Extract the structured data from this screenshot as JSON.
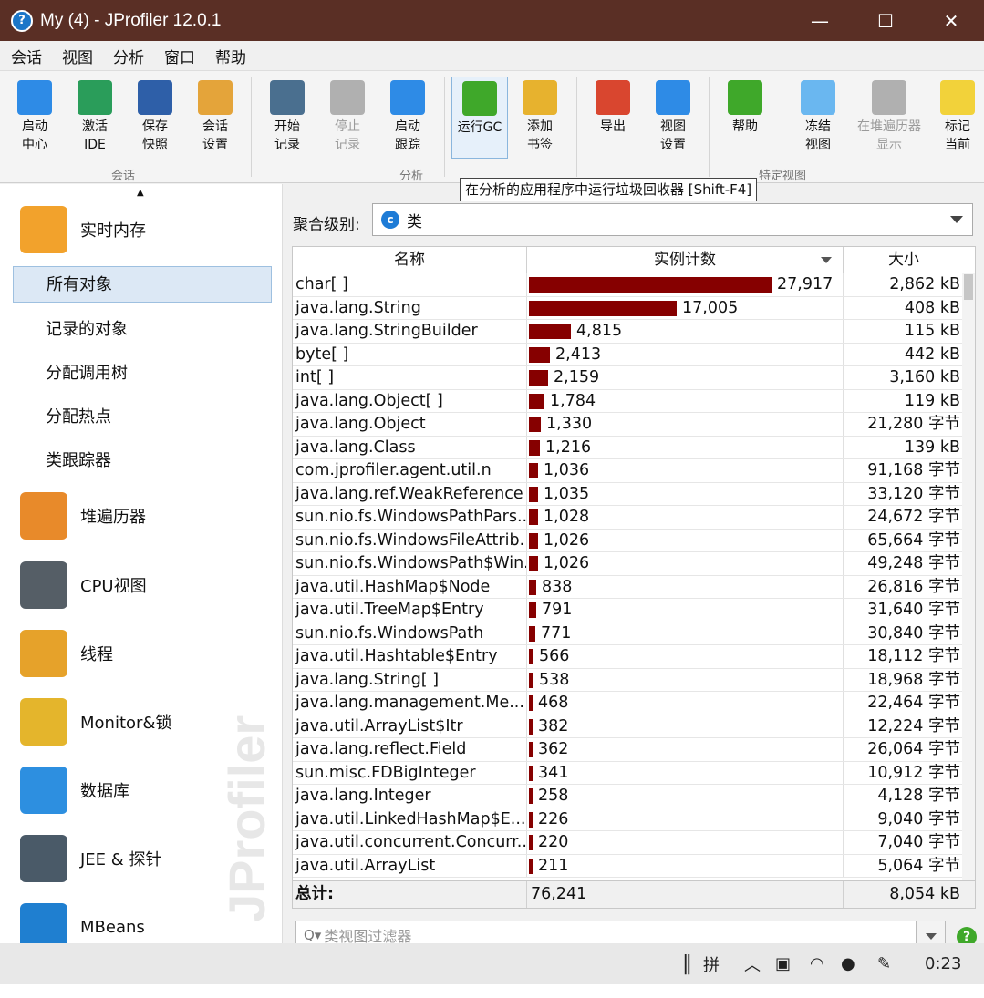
{
  "window": {
    "title": "My (4) - JProfiler 12.0.1",
    "minimize": "—",
    "maximize": "☐",
    "close": "✕"
  },
  "menu": [
    "会话",
    "视图",
    "分析",
    "窗口",
    "帮助"
  ],
  "toolbar": {
    "buttons": [
      {
        "label": "启动\n中心",
        "icon": "launch-center-icon",
        "color": "#2e8be6"
      },
      {
        "label": "激活\nIDE",
        "icon": "ide-icon",
        "color": "#2a9d5a"
      },
      {
        "label": "保存\n快照",
        "icon": "floppy-icon",
        "color": "#2e5fa8"
      },
      {
        "label": "会话\n设置",
        "icon": "clipboard-edit-icon",
        "color": "#e4a43a"
      },
      {
        "label": "开始\n记录",
        "icon": "film-reel-icon",
        "color": "#4a6f8f"
      },
      {
        "label": "停止\n记录",
        "icon": "film-reel-stop-icon",
        "color": "#b0b0b0"
      },
      {
        "label": "启动\n跟踪",
        "icon": "tracking-icon",
        "color": "#2e8be6"
      },
      {
        "label": "运行GC",
        "icon": "recycle-icon",
        "color": "#3fa82a"
      },
      {
        "label": "添加\n书签",
        "icon": "bookmark-icon",
        "color": "#e7b22e"
      },
      {
        "label": "导出",
        "icon": "export-icon",
        "color": "#d9462f"
      },
      {
        "label": "视图\n设置",
        "icon": "view-settings-icon",
        "color": "#2e8be6"
      },
      {
        "label": "帮助",
        "icon": "help-icon",
        "color": "#3fa82a"
      },
      {
        "label": "冻结\n视图",
        "icon": "snowflake-icon",
        "color": "#6ab7f0"
      },
      {
        "label": "在堆遍历器\n显示",
        "icon": "camera-icon",
        "color": "#b0b0b0"
      },
      {
        "label": "标记\n当前",
        "icon": "sticky-note-icon",
        "color": "#f2d23a"
      }
    ],
    "groups": [
      "会话",
      "分析",
      "特定视图"
    ]
  },
  "tooltip": "在分析的应用程序中运行垃圾回收器 [Shift-F4]",
  "sidebar": {
    "live_memory": "实时内存",
    "sub_items": [
      "所有对象",
      "记录的对象",
      "分配调用树",
      "分配热点",
      "类跟踪器"
    ],
    "categories": [
      "堆遍历器",
      "CPU视图",
      "线程",
      "Monitor&锁",
      "数据库",
      "JEE & 探针",
      "MBeans"
    ],
    "watermark": "JProfiler"
  },
  "main": {
    "aggregation_label": "聚合级别:",
    "aggregation_value": "类",
    "columns": [
      "名称",
      "实例计数",
      "大小"
    ],
    "rows": [
      {
        "name": "char[ ]",
        "count": 27917,
        "count_text": "27,917",
        "size": "2,862 kB"
      },
      {
        "name": "java.lang.String",
        "count": 17005,
        "count_text": "17,005",
        "size": "408 kB"
      },
      {
        "name": "java.lang.StringBuilder",
        "count": 4815,
        "count_text": "4,815",
        "size": "115 kB"
      },
      {
        "name": "byte[ ]",
        "count": 2413,
        "count_text": "2,413",
        "size": "442 kB"
      },
      {
        "name": "int[ ]",
        "count": 2159,
        "count_text": "2,159",
        "size": "3,160 kB"
      },
      {
        "name": "java.lang.Object[ ]",
        "count": 1784,
        "count_text": "1,784",
        "size": "119 kB"
      },
      {
        "name": "java.lang.Object",
        "count": 1330,
        "count_text": "1,330",
        "size": "21,280 字节"
      },
      {
        "name": "java.lang.Class",
        "count": 1216,
        "count_text": "1,216",
        "size": "139 kB"
      },
      {
        "name": "com.jprofiler.agent.util.n",
        "count": 1036,
        "count_text": "1,036",
        "size": "91,168 字节"
      },
      {
        "name": "java.lang.ref.WeakReference",
        "count": 1035,
        "count_text": "1,035",
        "size": "33,120 字节"
      },
      {
        "name": "sun.nio.fs.WindowsPathPars...",
        "count": 1028,
        "count_text": "1,028",
        "size": "24,672 字节"
      },
      {
        "name": "sun.nio.fs.WindowsFileAttrib...",
        "count": 1026,
        "count_text": "1,026",
        "size": "65,664 字节"
      },
      {
        "name": "sun.nio.fs.WindowsPath$Win...",
        "count": 1026,
        "count_text": "1,026",
        "size": "49,248 字节"
      },
      {
        "name": "java.util.HashMap$Node",
        "count": 838,
        "count_text": "838",
        "size": "26,816 字节"
      },
      {
        "name": "java.util.TreeMap$Entry",
        "count": 791,
        "count_text": "791",
        "size": "31,640 字节"
      },
      {
        "name": "sun.nio.fs.WindowsPath",
        "count": 771,
        "count_text": "771",
        "size": "30,840 字节"
      },
      {
        "name": "java.util.Hashtable$Entry",
        "count": 566,
        "count_text": "566",
        "size": "18,112 字节"
      },
      {
        "name": "java.lang.String[ ]",
        "count": 538,
        "count_text": "538",
        "size": "18,968 字节"
      },
      {
        "name": "java.lang.management.Me...",
        "count": 468,
        "count_text": "468",
        "size": "22,464 字节"
      },
      {
        "name": "java.util.ArrayList$Itr",
        "count": 382,
        "count_text": "382",
        "size": "12,224 字节"
      },
      {
        "name": "java.lang.reflect.Field",
        "count": 362,
        "count_text": "362",
        "size": "26,064 字节"
      },
      {
        "name": "sun.misc.FDBigInteger",
        "count": 341,
        "count_text": "341",
        "size": "10,912 字节"
      },
      {
        "name": "java.lang.Integer",
        "count": 258,
        "count_text": "258",
        "size": "4,128 字节"
      },
      {
        "name": "java.util.LinkedHashMap$E...",
        "count": 226,
        "count_text": "226",
        "size": "9,040 字节"
      },
      {
        "name": "java.util.concurrent.Concurr...",
        "count": 220,
        "count_text": "220",
        "size": "7,040 字节"
      },
      {
        "name": "java.util.ArrayList",
        "count": 211,
        "count_text": "211",
        "size": "5,064 字节"
      }
    ],
    "total": {
      "label": "总计:",
      "count": "76,241",
      "size": "8,054 kB"
    },
    "filter_placeholder": "类视图过滤器"
  },
  "taskbar": {
    "ime": "拼",
    "time": "0:23"
  }
}
